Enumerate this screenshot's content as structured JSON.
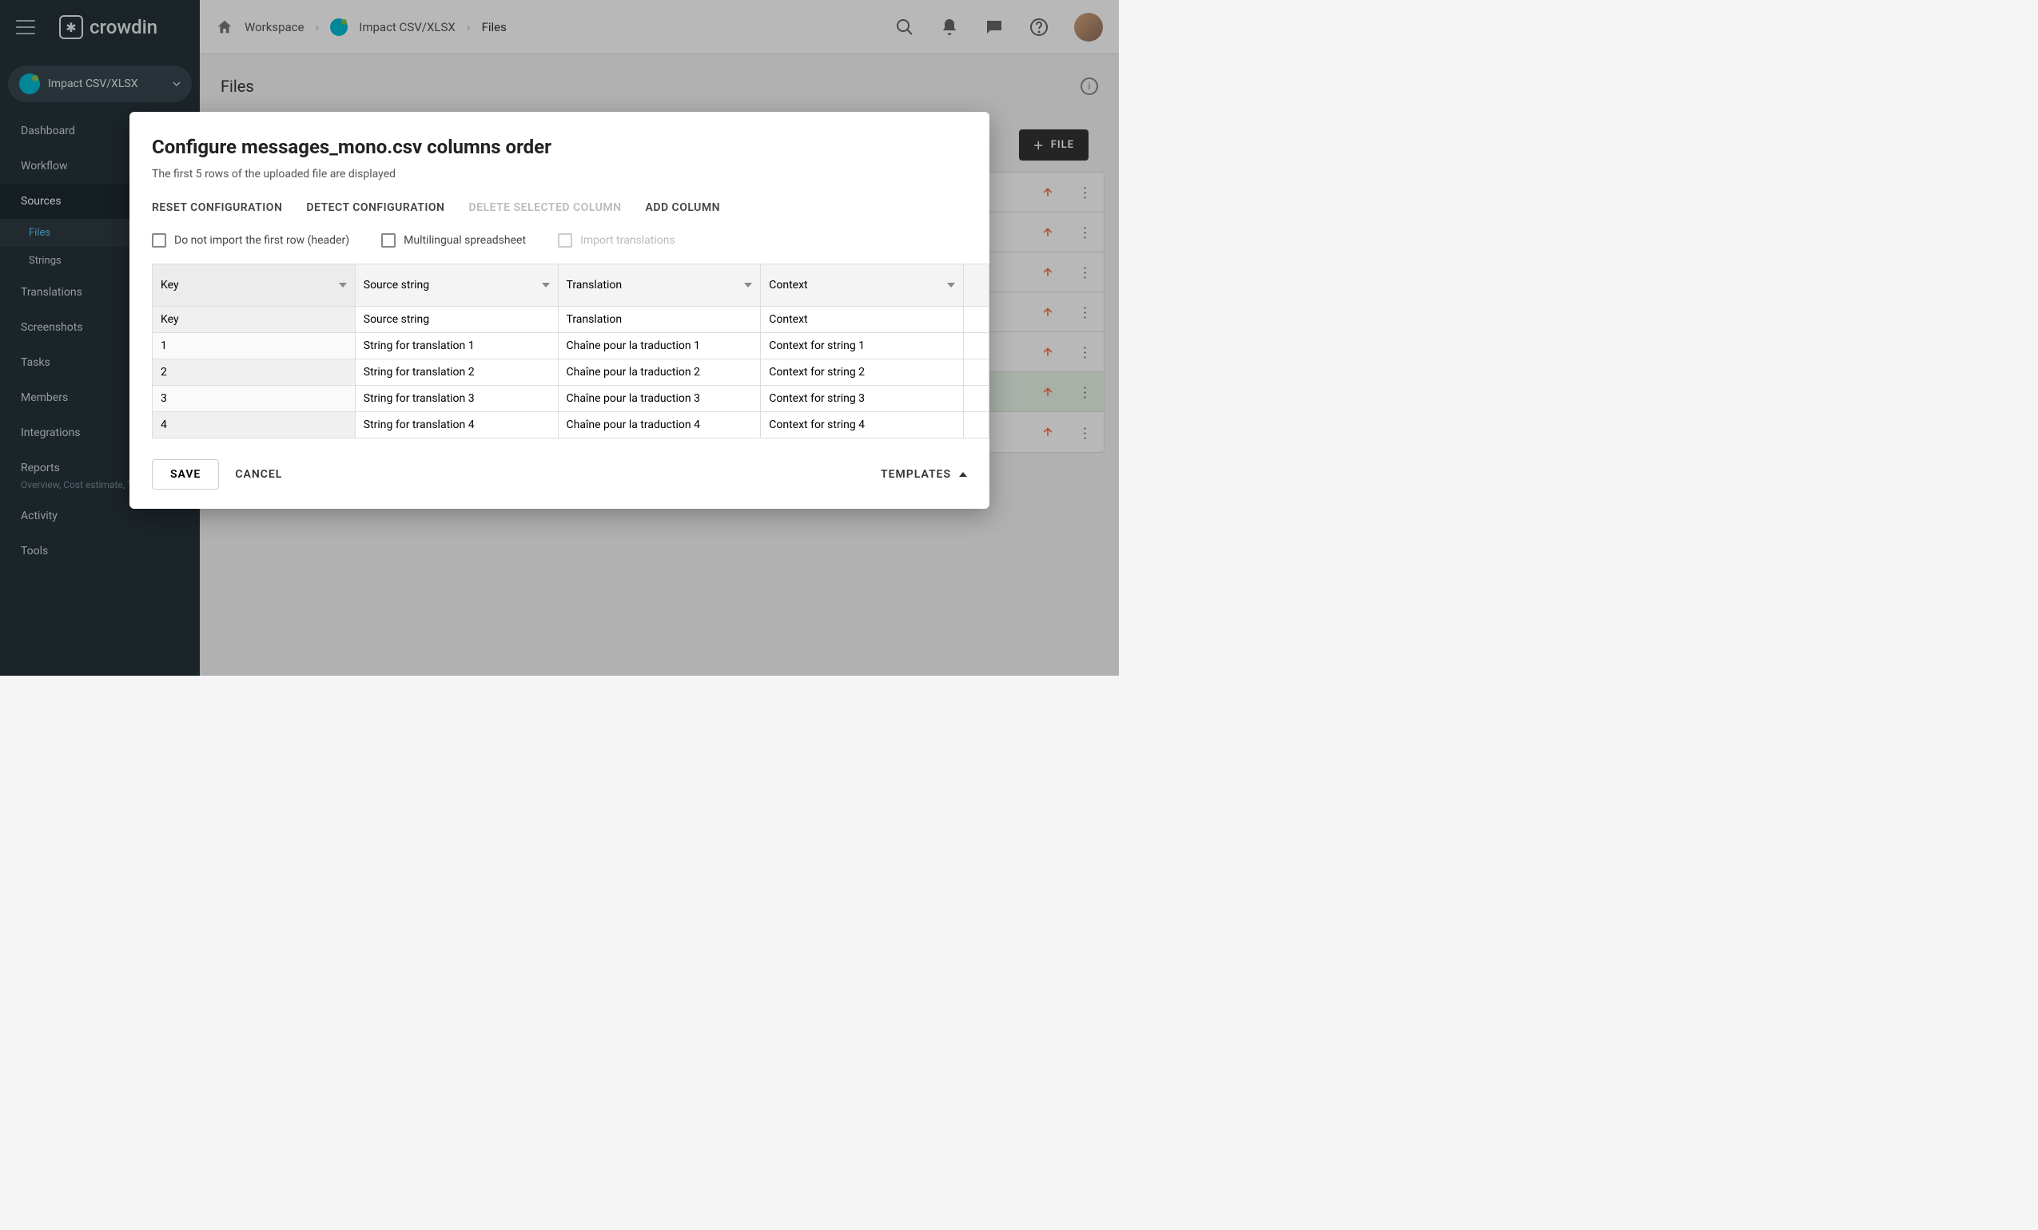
{
  "brand": "crowdin",
  "project_name": "Impact CSV/XLSX",
  "breadcrumb": {
    "workspace": "Workspace",
    "project": "Impact CSV/XLSX",
    "current": "Files"
  },
  "sidebar": {
    "items": [
      {
        "label": "Dashboard"
      },
      {
        "label": "Workflow"
      },
      {
        "label": "Sources"
      },
      {
        "label": "Translations"
      },
      {
        "label": "Screenshots"
      },
      {
        "label": "Tasks"
      },
      {
        "label": "Members"
      },
      {
        "label": "Integrations"
      },
      {
        "label": "Reports"
      },
      {
        "label": "Activity"
      },
      {
        "label": "Tools"
      }
    ],
    "sources_sub": [
      {
        "label": "Files"
      },
      {
        "label": "Strings"
      }
    ],
    "reports_caption": "Overview, Cost estimate, Transl…"
  },
  "page": {
    "title": "Files",
    "file_button": "FILE"
  },
  "dialog": {
    "title": "Configure messages_mono.csv columns order",
    "subtitle": "The first 5 rows of the uploaded file are displayed",
    "actions": {
      "reset": "RESET CONFIGURATION",
      "detect": "DETECT CONFIGURATION",
      "delete": "DELETE SELECTED COLUMN",
      "add": "ADD COLUMN"
    },
    "checks": {
      "header": "Do not import the first row (header)",
      "multilingual": "Multilingual spreadsheet",
      "import_tr": "Import translations"
    },
    "columns": [
      "Key",
      "Source string",
      "Translation",
      "Context"
    ],
    "rows": [
      [
        "Key",
        "Source string",
        "Translation",
        "Context"
      ],
      [
        "1",
        "String for translation 1",
        "Chaîne pour la traduction 1",
        "Context for string 1"
      ],
      [
        "2",
        "String for translation 2",
        "Chaîne pour la traduction 2",
        "Context for string 2"
      ],
      [
        "3",
        "String for translation 3",
        "Chaîne pour la traduction 3",
        "Context for string 3"
      ],
      [
        "4",
        "String for translation 4",
        "Chaîne pour la traduction 4",
        "Context for string 4"
      ]
    ],
    "footer": {
      "save": "SAVE",
      "cancel": "CANCEL",
      "templates": "TEMPLATES"
    }
  }
}
